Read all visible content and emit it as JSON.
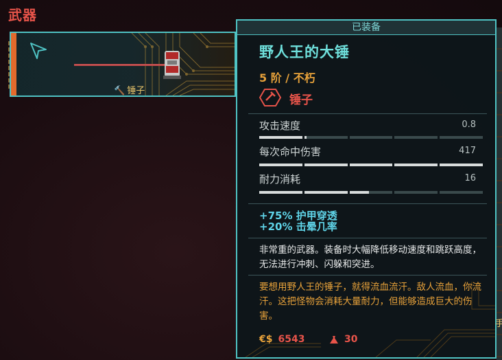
{
  "section": {
    "title": "武器"
  },
  "slot": {
    "type_label": "锤子",
    "type_icon": "hammer-icon",
    "cursor_icon": "pointer-cursor-icon",
    "accent": "#e36a2c",
    "border": "#4fc3c4"
  },
  "tooltip": {
    "header": "已装备",
    "name": "野人王的大锤",
    "tier": "5 阶 / 不朽",
    "type_icon": "hexagon-hammer-icon",
    "type_label": "锤子",
    "stats": [
      {
        "label": "攻击速度",
        "value": "0.8",
        "fill": 0.21
      },
      {
        "label": "每次命中伤害",
        "value": "417",
        "fill": 1.0
      },
      {
        "label": "耐力消耗",
        "value": "16",
        "fill": 0.49
      }
    ],
    "bonuses": [
      "+75% 护甲穿透",
      "+20% 击晕几率"
    ],
    "description": "非常重的武器。装备时大幅降低移动速度和跳跃高度，无法进行冲刺、闪躲和突进。",
    "lore": "要想用野人王的锤子，就得流血流汗。敌人流血，你流汗。这把怪物会消耗大量耐力，但能够造成巨大的伤害。",
    "price_icon": "eurodollar-icon",
    "price_symbol": "€$",
    "price": "6543",
    "weight_icon": "weight-icon",
    "weight": "30"
  },
  "colors": {
    "name": "#6fe0dc",
    "tier": "#e8a23a",
    "type": "#e8544a",
    "bonus": "#5fd4e8",
    "lore": "#e8a23a",
    "frame": "#4fc3c4"
  },
  "edge": {
    "right_char": "手"
  }
}
